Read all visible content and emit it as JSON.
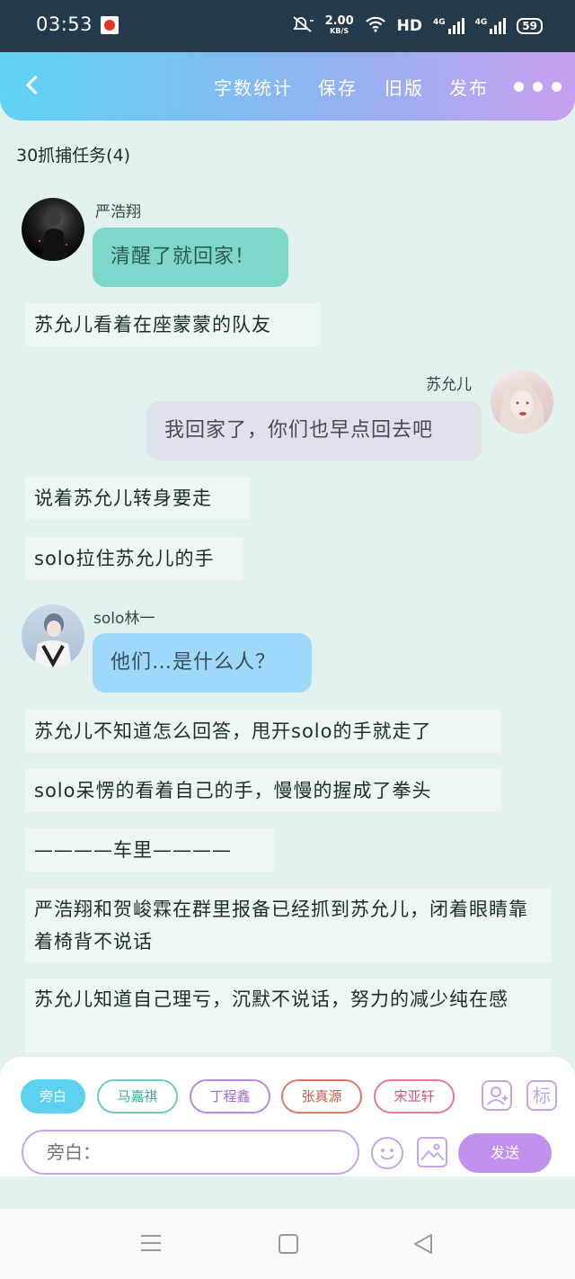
{
  "status_bar": {
    "time": "03:53",
    "net_speed": "2.00",
    "net_unit": "KB/S",
    "hd_label": "HD",
    "signal1_label": "4G",
    "signal2_label": "4G",
    "battery": "59"
  },
  "toolbar": {
    "word_count": "字数统计",
    "save": "保存",
    "old_version": "旧版",
    "publish": "发布"
  },
  "chapter": {
    "title": "30抓捕任务(4)"
  },
  "messages": [
    {
      "type": "character",
      "name": "严浩翔",
      "text": "清醒了就回家！"
    },
    {
      "type": "narration",
      "text": "苏允儿看着在座蒙蒙的队友"
    },
    {
      "type": "character",
      "name": "苏允儿",
      "text": "我回家了，你们也早点回去吧"
    },
    {
      "type": "narration",
      "text": "说着苏允儿转身要走"
    },
    {
      "type": "narration",
      "text": "solo拉住苏允儿的手"
    },
    {
      "type": "character",
      "name": "solo林一",
      "text": "他们…是什么人？"
    },
    {
      "type": "narration",
      "text": "苏允儿不知道怎么回答，甩开solo的手就走了"
    },
    {
      "type": "narration",
      "text": "solo呆愣的看着自己的手，慢慢的握成了拳头"
    },
    {
      "type": "narration",
      "text": "————车里————"
    },
    {
      "type": "narration",
      "text": "严浩翔和贺峻霖在群里报备已经抓到苏允儿，闭着眼睛靠着椅背不说话"
    },
    {
      "type": "narration",
      "text": "苏允儿知道自己理亏，沉默不说话，努力的减少纯在感"
    }
  ],
  "composer": {
    "roles": [
      "旁白",
      "马嘉祺",
      "丁程鑫",
      "张真源",
      "宋亚轩"
    ],
    "mark_label": "标",
    "input_placeholder": "旁白：",
    "send_label": "发送"
  },
  "colors": {
    "accent_cyan": "#5fd3f3",
    "accent_purple": "#c091ec",
    "bubble_teal": "#7fd7c9",
    "bubble_gray": "#dde3e8",
    "bubble_blue": "#9fd9fa"
  }
}
